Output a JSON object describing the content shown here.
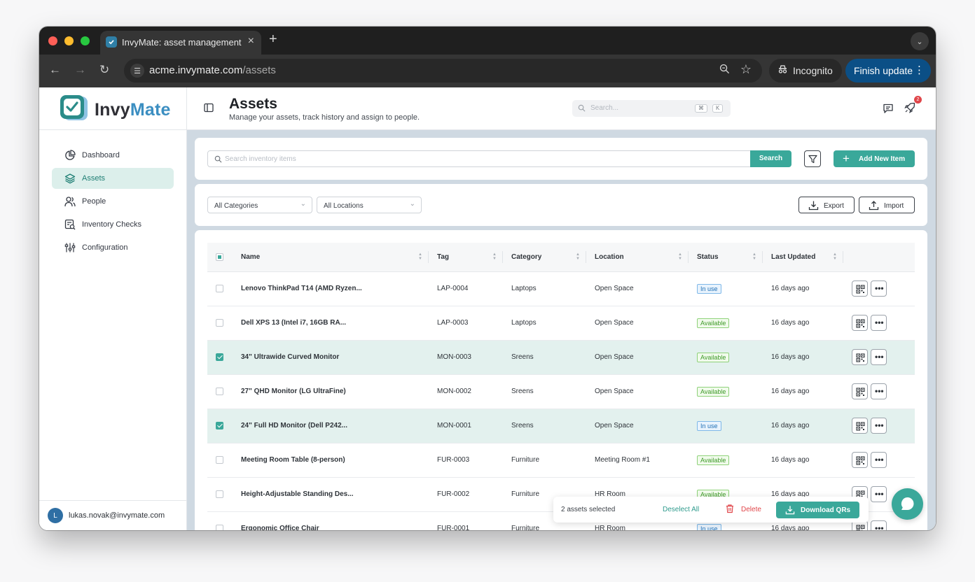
{
  "browser": {
    "tab_title": "InvyMate: asset management",
    "url_host": "acme.invymate.com",
    "url_path": "/assets",
    "incognito_label": "Incognito",
    "finish_update_label": "Finish update"
  },
  "brand": {
    "name_part1": "Invy",
    "name_part2": "Mate",
    "accent_color": "#3aa89a"
  },
  "sidebar": {
    "items": [
      {
        "label": "Dashboard",
        "icon": "pie-chart-icon",
        "active": false
      },
      {
        "label": "Assets",
        "icon": "layers-icon",
        "active": true
      },
      {
        "label": "People",
        "icon": "users-icon",
        "active": false
      },
      {
        "label": "Inventory Checks",
        "icon": "checklist-search-icon",
        "active": false
      },
      {
        "label": "Configuration",
        "icon": "sliders-icon",
        "active": false
      }
    ],
    "user": {
      "initial": "L",
      "email": "lukas.novak@invymate.com"
    }
  },
  "header": {
    "title": "Assets",
    "subtitle": "Manage your assets, track history and assign to people.",
    "search_placeholder": "Search...",
    "shortcut_keys": [
      "⌘",
      "K"
    ],
    "notification_count": "2"
  },
  "toolbar": {
    "search_placeholder": "Search inventory items",
    "search_button": "Search",
    "add_button": "Add New Item"
  },
  "filters": {
    "category": "All Categories",
    "location": "All Locations",
    "export_button": "Export",
    "import_button": "Import"
  },
  "table": {
    "columns": [
      "Name",
      "Tag",
      "Category",
      "Location",
      "Status",
      "Last Updated"
    ],
    "rows": [
      {
        "name": "Lenovo ThinkPad T14 (AMD Ryzen...",
        "tag": "LAP-0004",
        "category": "Laptops",
        "location": "Open Space",
        "status": "In use",
        "updated": "16 days ago",
        "selected": false
      },
      {
        "name": "Dell XPS 13 (Intel i7, 16GB RA...",
        "tag": "LAP-0003",
        "category": "Laptops",
        "location": "Open Space",
        "status": "Available",
        "updated": "16 days ago",
        "selected": false
      },
      {
        "name": "34\" Ultrawide Curved Monitor",
        "tag": "MON-0003",
        "category": "Sreens",
        "location": "Open Space",
        "status": "Available",
        "updated": "16 days ago",
        "selected": true
      },
      {
        "name": "27\" QHD Monitor (LG UltraFine)",
        "tag": "MON-0002",
        "category": "Sreens",
        "location": "Open Space",
        "status": "Available",
        "updated": "16 days ago",
        "selected": false
      },
      {
        "name": "24\" Full HD Monitor (Dell P242...",
        "tag": "MON-0001",
        "category": "Sreens",
        "location": "Open Space",
        "status": "In use",
        "updated": "16 days ago",
        "selected": true
      },
      {
        "name": "Meeting Room Table (8-person)",
        "tag": "FUR-0003",
        "category": "Furniture",
        "location": "Meeting Room #1",
        "status": "Available",
        "updated": "16 days ago",
        "selected": false
      },
      {
        "name": "Height-Adjustable Standing Des...",
        "tag": "FUR-0002",
        "category": "Furniture",
        "location": "HR Room",
        "status": "Available",
        "updated": "16 days ago",
        "selected": false
      },
      {
        "name": "Ergonomic Office Chair",
        "tag": "FUR-0001",
        "category": "Furniture",
        "location": "HR Room",
        "status": "In use",
        "updated": "16 days ago",
        "selected": false
      }
    ]
  },
  "selection_bar": {
    "count_text": "2 assets selected",
    "deselect_label": "Deselect All",
    "delete_label": "Delete",
    "download_label": "Download QRs"
  }
}
